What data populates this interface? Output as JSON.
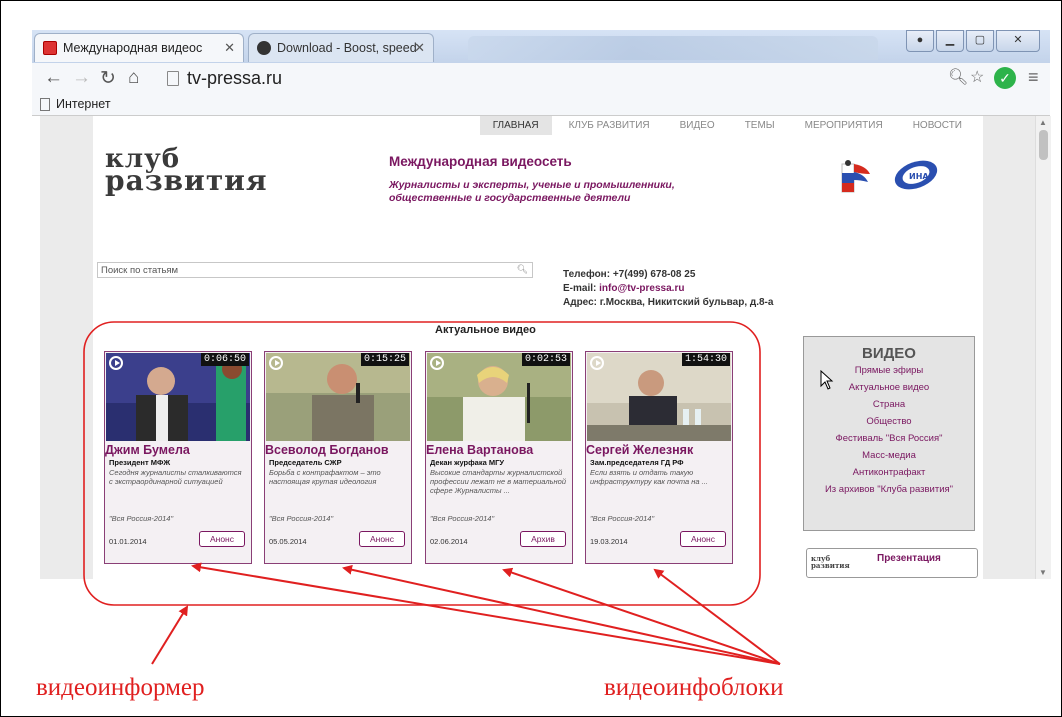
{
  "browser": {
    "tabs": [
      {
        "title": "Международная видеос",
        "favicon": "red-square-icon"
      },
      {
        "title": "Download - Boost, speed",
        "favicon": "dark-circle-icon"
      }
    ],
    "url": "tv-pressa.ru",
    "bookmark": "Интернет"
  },
  "site": {
    "nav": [
      "ГЛАВНАЯ",
      "КЛУБ РАЗВИТИЯ",
      "ВИДЕО",
      "ТЕМЫ",
      "МЕРОПРИЯТИЯ",
      "НОВОСТИ"
    ],
    "logo_line1": "клуб",
    "logo_line2": "развития",
    "title": "Международная видеосеть",
    "tagline_line1": "Журналисты и эксперты, ученые и промышленники,",
    "tagline_line2": "общественные и государственные деятели",
    "search_placeholder": "Поиск по статьям",
    "phone": "Телефон: +7(499) 678-08 25",
    "email_label": "E-mail: ",
    "email": "info@tv-pressa.ru",
    "address": "Адрес: г.Москва, Никитский бульвар, д.8-а",
    "informer_title": "Актуальное видео",
    "cards": [
      {
        "duration": "0:06:50",
        "name": "Джим Бумела",
        "role": "Президент МФЖ",
        "desc": "Сегодня журналисты сталкиваются с экстраординарной ситуацией",
        "source": "\"Вся Россия-2014\"",
        "date": "01.01.2014",
        "button": "Анонс"
      },
      {
        "duration": "0:15:25",
        "name": "Всеволод Богданов",
        "role": "Председатель СЖР",
        "desc": "Борьба с контрафактом – это настоящая крутая идеология",
        "source": "\"Вся Россия-2014\"",
        "date": "05.05.2014",
        "button": "Анонс"
      },
      {
        "duration": "0:02:53",
        "name": "Елена Вартанова",
        "role": "Декан журфака МГУ",
        "desc": "Высокие стандарты журналистской профессии лежат не в материальной сфере Журналисты ...",
        "source": "\"Вся Россия-2014\"",
        "date": "02.06.2014",
        "button": "Архив"
      },
      {
        "duration": "1:54:30",
        "name": "Сергей Железняк",
        "role": "Зам.председателя ГД РФ",
        "desc": "Если взять и отдать такую инфраструктуру как почта на ...",
        "source": "\"Вся Россия-2014\"",
        "date": "19.03.2014",
        "button": "Анонс"
      }
    ],
    "video_box": {
      "title": "ВИДЕО",
      "links": [
        "Прямые эфиры",
        "Актуальное видео",
        "Страна",
        "Общество",
        "Фестиваль \"Вся Россия\"",
        "Масс-медиа",
        "Антиконтрафакт",
        "Из архивов \"Клуба развития\""
      ]
    },
    "presentation_label": "Презентация",
    "presentation_logo_1": "клуб",
    "presentation_logo_2": "развития"
  },
  "annotations": {
    "informer_label": "видеоинформер",
    "infoblocks_label": "видеоинфоблоки",
    "color": "#e02020"
  }
}
